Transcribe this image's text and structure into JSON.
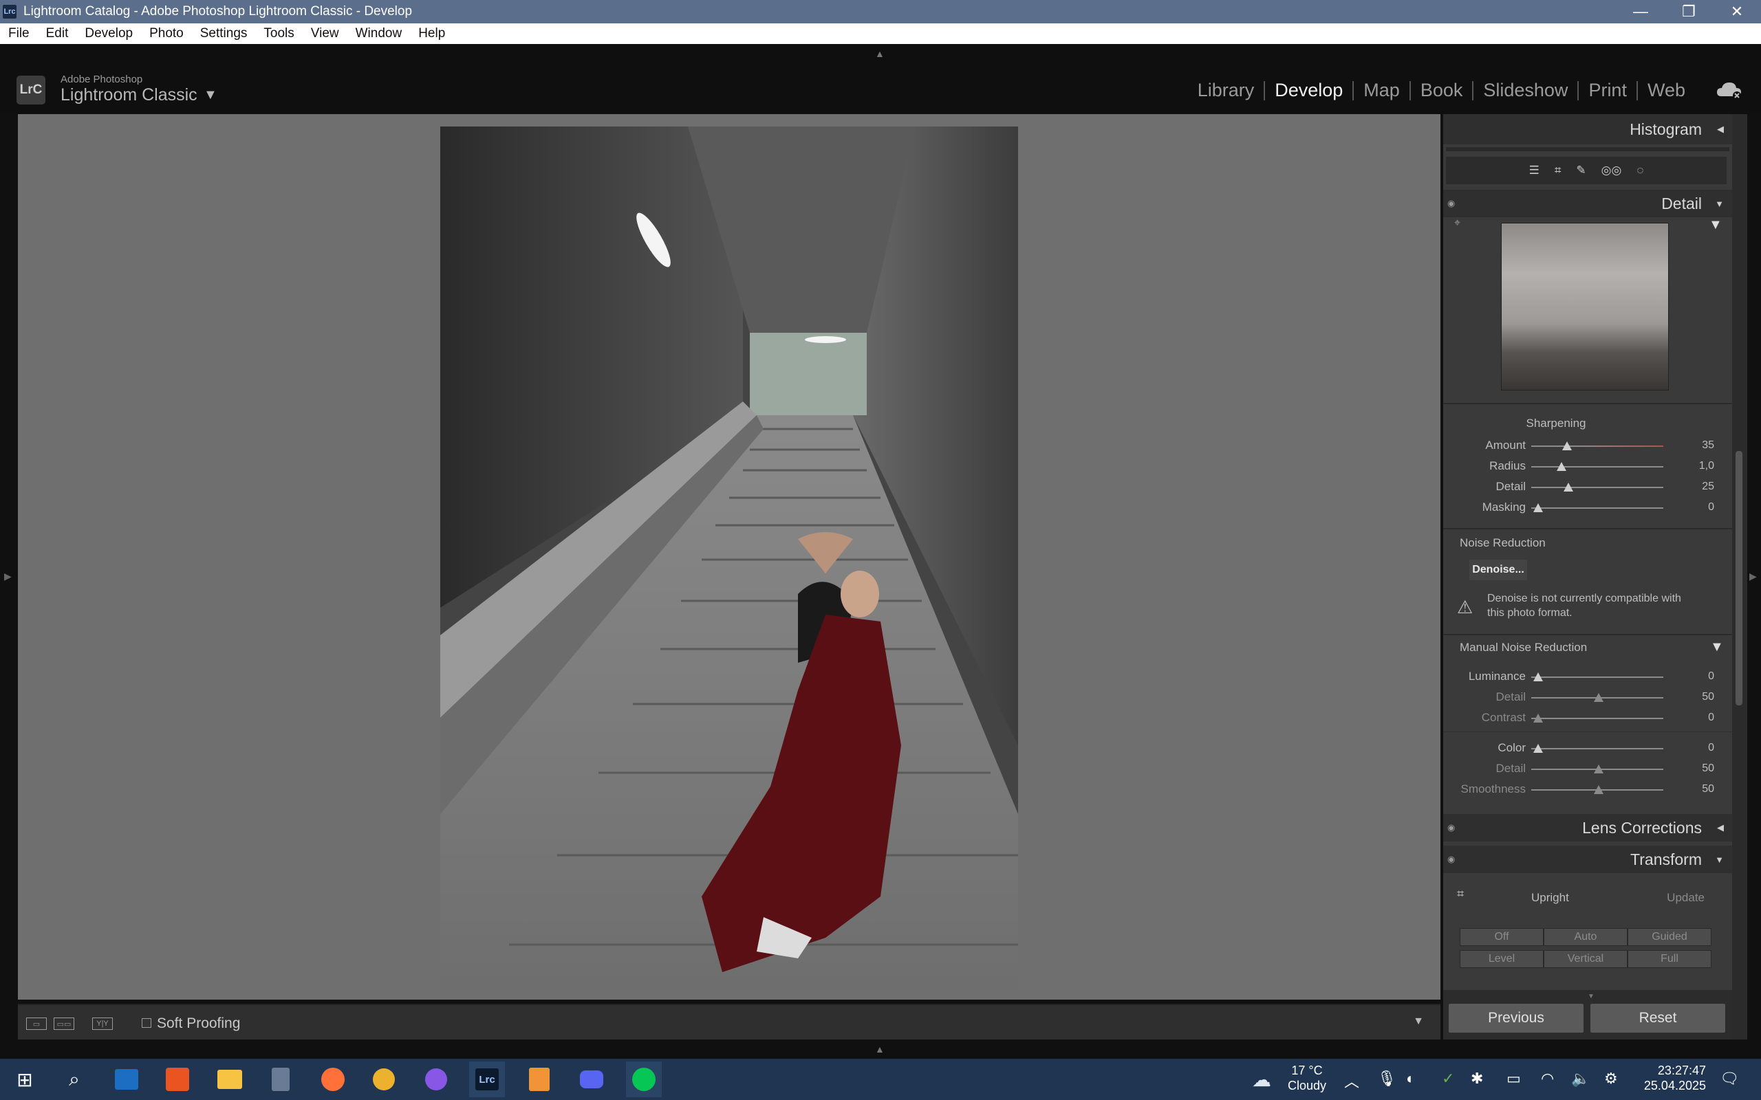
{
  "window": {
    "title": "Lightroom Catalog - Adobe Photoshop Lightroom Classic - Develop",
    "app_icon": "Lrc"
  },
  "menu": [
    "File",
    "Edit",
    "Develop",
    "Photo",
    "Settings",
    "Tools",
    "View",
    "Window",
    "Help"
  ],
  "identity": {
    "logo": "LrC",
    "subtitle": "Adobe Photoshop",
    "name": "Lightroom Classic",
    "caret": "▼"
  },
  "modules": [
    {
      "label": "Library",
      "active": false
    },
    {
      "label": "Develop",
      "active": true
    },
    {
      "label": "Map",
      "active": false
    },
    {
      "label": "Book",
      "active": false
    },
    {
      "label": "Slideshow",
      "active": false
    },
    {
      "label": "Print",
      "active": false
    },
    {
      "label": "Web",
      "active": false
    }
  ],
  "toolbar": {
    "soft_proofing": "Soft Proofing"
  },
  "panels": {
    "histogram": "Histogram",
    "detail": "Detail",
    "sharpening": {
      "title": "Sharpening",
      "sliders": [
        {
          "label": "Amount",
          "value": "35",
          "pos": 0.27
        },
        {
          "label": "Radius",
          "value": "1,0",
          "pos": 0.23
        },
        {
          "label": "Detail",
          "value": "25",
          "pos": 0.28
        },
        {
          "label": "Masking",
          "value": "0",
          "pos": 0.05
        }
      ]
    },
    "noise_reduction": {
      "title": "Noise Reduction",
      "denoise_button": "Denoise...",
      "warning": "Denoise is not currently compatible with this photo format.",
      "manual_title": "Manual Noise Reduction",
      "sliders": [
        {
          "label": "Luminance",
          "value": "0",
          "pos": 0.05,
          "enabled": true
        },
        {
          "label": "Detail",
          "value": "50",
          "pos": 0.51,
          "enabled": false
        },
        {
          "label": "Contrast",
          "value": "0",
          "pos": 0.05,
          "enabled": false
        },
        {
          "label": "Color",
          "value": "0",
          "pos": 0.05,
          "enabled": true
        },
        {
          "label": "Detail",
          "value": "50",
          "pos": 0.51,
          "enabled": false
        },
        {
          "label": "Smoothness",
          "value": "50",
          "pos": 0.51,
          "enabled": false
        }
      ]
    },
    "lens_corrections": "Lens Corrections",
    "transform": {
      "title": "Transform",
      "upright": "Upright",
      "update": "Update",
      "buttons_row1": [
        "Off",
        "Auto",
        "Guided"
      ],
      "buttons_row2": [
        "Level",
        "Vertical",
        "Full"
      ]
    },
    "previous": "Previous",
    "reset": "Reset"
  },
  "taskbar": {
    "weather_temp": "17 °C",
    "weather_desc": "Cloudy",
    "time": "23:27:47",
    "date": "25.04.2025"
  }
}
